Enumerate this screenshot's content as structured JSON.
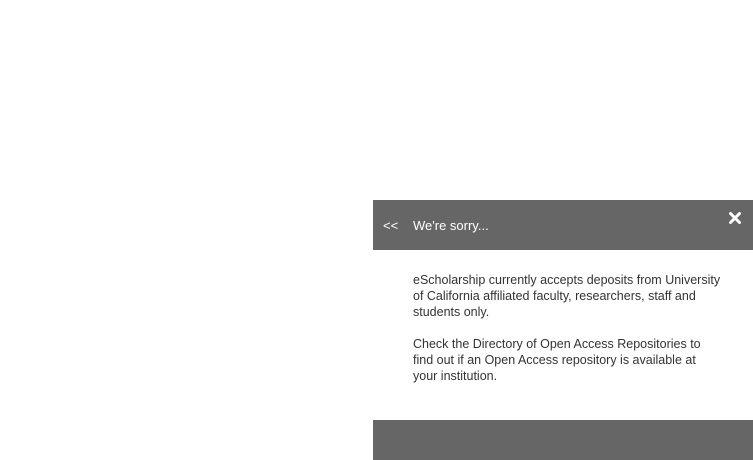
{
  "dialog": {
    "back_label": "<<",
    "title": "We're sorry...",
    "close_icon": "close-x-icon",
    "paragraphs": [
      "eScholarship currently accepts deposits from University of California affiliated faculty, researchers, staff and students only.",
      "Check the Directory of Open Access Repositories to find out if an Open Access repository is available at your institution."
    ]
  },
  "colors": {
    "header_bg": "#666666",
    "footer_bg": "#666666",
    "header_text": "#ffffff",
    "body_text": "#333333",
    "page_bg": "#ffffff"
  }
}
